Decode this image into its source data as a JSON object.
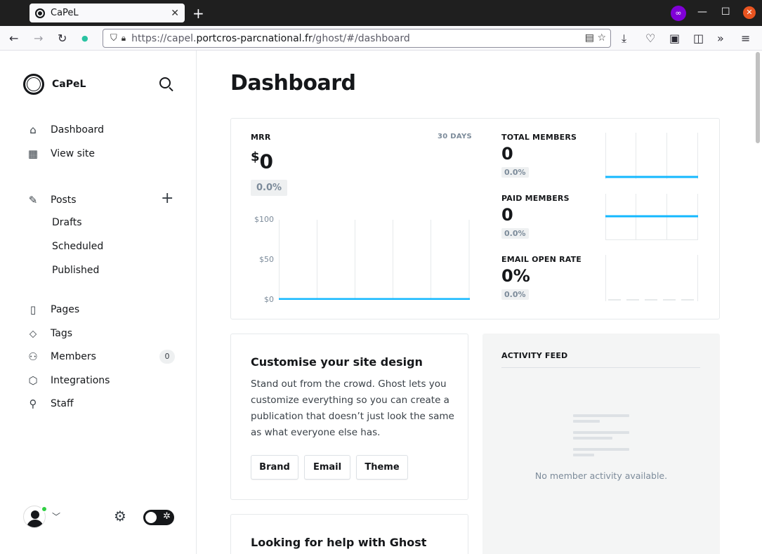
{
  "browser": {
    "tab_title": "CaPeL",
    "tab_close": "✕",
    "new_tab": "+",
    "url_prefix": "https://capel.",
    "url_domain": "portcros-parcnational.fr",
    "url_path": "/ghost/#/dashboard",
    "minimize": "—",
    "maximize": "☐",
    "close": "✕"
  },
  "sidebar": {
    "site_name": "CaPeL",
    "nav": [
      {
        "label": "Dashboard",
        "icon": "home-icon"
      },
      {
        "label": "View site",
        "icon": "layout-icon"
      },
      {
        "label": "Posts",
        "icon": "pencil-icon"
      },
      {
        "label": "Pages",
        "icon": "page-icon"
      },
      {
        "label": "Tags",
        "icon": "tag-icon"
      },
      {
        "label": "Members",
        "icon": "members-icon"
      },
      {
        "label": "Integrations",
        "icon": "box-icon"
      },
      {
        "label": "Staff",
        "icon": "staff-icon"
      }
    ],
    "posts_sub": [
      "Drafts",
      "Scheduled",
      "Published"
    ],
    "members_count": "0"
  },
  "main": {
    "title": "Dashboard",
    "mrr": {
      "label": "MRR",
      "range": "30 DAYS",
      "currency": "$",
      "value": "0",
      "change": "0.0%",
      "y_ticks": [
        "$100",
        "$50",
        "$0"
      ]
    },
    "stats": [
      {
        "label": "TOTAL MEMBERS",
        "value": "0",
        "change": "0.0%"
      },
      {
        "label": "PAID MEMBERS",
        "value": "0",
        "change": "0.0%"
      },
      {
        "label": "EMAIL OPEN RATE",
        "value": "0%",
        "change": "0.0%"
      }
    ],
    "design": {
      "title": "Customise your site design",
      "description": "Stand out from the crowd. Ghost lets you customize everything so you can create a publication that doesn’t just look the same as what everyone else has.",
      "buttons": [
        "Brand",
        "Email",
        "Theme"
      ]
    },
    "activity": {
      "title": "ACTIVITY FEED",
      "empty": "No member activity available."
    },
    "help": {
      "title": "Looking for help with Ghost"
    }
  },
  "colors": {
    "accent": "#14b8ff",
    "text": "#15171a",
    "muted": "#7c8b9a"
  }
}
